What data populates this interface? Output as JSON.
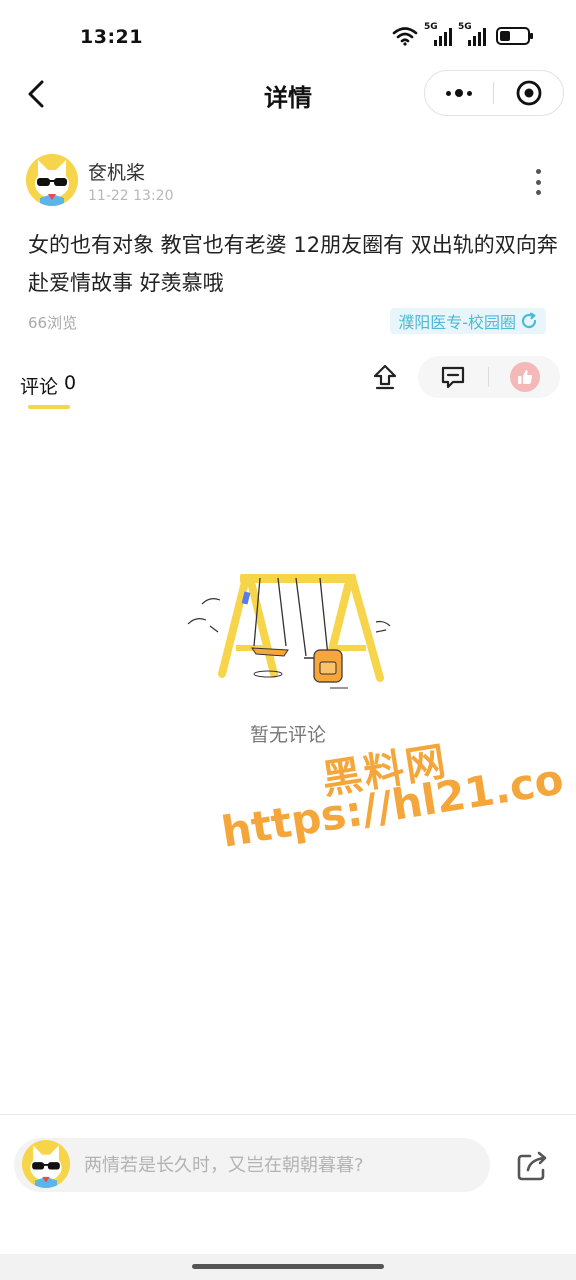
{
  "status_bar": {
    "time": "13:21",
    "network_1": "5G",
    "network_2": "5G",
    "icons": [
      "wifi-icon",
      "signal-5g-icon",
      "signal-5g-icon",
      "battery-icon"
    ]
  },
  "nav": {
    "title": "详情",
    "back_icon": "chevron-left-icon",
    "more_icon": "more-dots-icon",
    "close_icon": "target-close-icon"
  },
  "post": {
    "author": "奁杋桨",
    "time": "11-22 13:20",
    "content": "女的也有对象 教官也有老婆 12朋友圈有 双出轨的双向奔赴爱情故事 好羡慕哦",
    "views": "66浏览",
    "circle": "濮阳医专-校园圈",
    "circle_color": "#4cb9d6"
  },
  "comments": {
    "tab_label": "评论",
    "count": "0",
    "empty_text": "暂无评论",
    "accent_color": "#f7d54b"
  },
  "watermark": {
    "title": "黑料网",
    "url": "https://hl21.co",
    "color": "#f5a63a"
  },
  "bottom_bar": {
    "placeholder": "两情若是长久时，又岂在朝朝暮暮?",
    "share_icon": "share-icon"
  }
}
